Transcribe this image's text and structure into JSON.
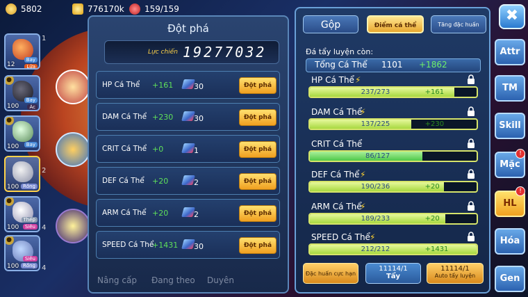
{
  "resources": {
    "gold": "5802",
    "coin": "776170k",
    "stamina": "159/159"
  },
  "roster": [
    {
      "level": "12",
      "tags": [
        "Bay",
        "Lửa"
      ],
      "index": "1"
    },
    {
      "level": "100",
      "tags": [
        "Bay",
        "Ác"
      ],
      "index": ""
    },
    {
      "level": "100",
      "tags": [
        "Bay"
      ],
      "index": ""
    },
    {
      "level": "100",
      "tags": [
        "Rồng"
      ],
      "index": "2"
    },
    {
      "level": "100",
      "tags": [
        "Thép",
        "Siêu"
      ],
      "index": "4"
    },
    {
      "level": "100",
      "tags": [
        "Siêu",
        "Rồng"
      ],
      "index": "4"
    }
  ],
  "breakthrough": {
    "title": "Đột phá",
    "power_label": "Lực chiến",
    "power_value": "19277032",
    "button_label": "Đột phá",
    "rows": [
      {
        "name": "HP Cá Thể",
        "bonus": "+161",
        "cost": "30"
      },
      {
        "name": "DAM Cá Thể",
        "bonus": "+230",
        "cost": "30"
      },
      {
        "name": "CRIT Cá Thể",
        "bonus": "+0",
        "cost": "1"
      },
      {
        "name": "DEF Cá Thể",
        "bonus": "+20",
        "cost": "2"
      },
      {
        "name": "ARM Cá Thể",
        "bonus": "+20",
        "cost": "2"
      },
      {
        "name": "SPEED Cá Thể",
        "bonus": "+1431",
        "cost": "30"
      }
    ]
  },
  "bottom_menu": {
    "upgrade": "Nâng cấp",
    "training": "Đang theo",
    "fate": "Duyên"
  },
  "tabs": {
    "merge": "Gộp",
    "individual_points": "Điểm cá thể",
    "special_training": "Tăng đặc huấn"
  },
  "remaining_label": "Đá tẩy luyện còn:",
  "total": {
    "label": "Tổng Cá Thể",
    "value": "1101",
    "bonus": "+1862"
  },
  "stats": [
    {
      "name": "HP Cá Thể",
      "value": "237/273",
      "bonus": "+161",
      "ratio": 0.868,
      "boosted": true
    },
    {
      "name": "DAM Cá Thể",
      "value": "137/225",
      "bonus": "+230",
      "ratio": 0.609,
      "boosted": true
    },
    {
      "name": "CRIT Cá Thể",
      "value": "86/127",
      "bonus": "",
      "ratio": 0.677,
      "boosted": false
    },
    {
      "name": "DEF Cá Thể",
      "value": "190/236",
      "bonus": "+20",
      "ratio": 0.805,
      "boosted": true
    },
    {
      "name": "ARM Cá Thể",
      "value": "189/233",
      "bonus": "+20",
      "ratio": 0.811,
      "boosted": true
    },
    {
      "name": "SPEED Cá Thể",
      "value": "212/212",
      "bonus": "+1431",
      "ratio": 1.0,
      "boosted": true
    }
  ],
  "actions": {
    "special_limit": "Đặc huấn cực hạn",
    "wash_count": "11114/1",
    "wash_label": "Tẩy",
    "auto_count": "11114/1",
    "auto_label": "Auto tẩy luyện"
  },
  "side_menu": [
    "Attr",
    "TM",
    "Skill",
    "Mặc",
    "HL",
    "Hóa",
    "Gen"
  ],
  "colors": {
    "bonus_green": "#5fe05a",
    "gold_button": "#f0a020",
    "panel": "#1f3a66"
  }
}
